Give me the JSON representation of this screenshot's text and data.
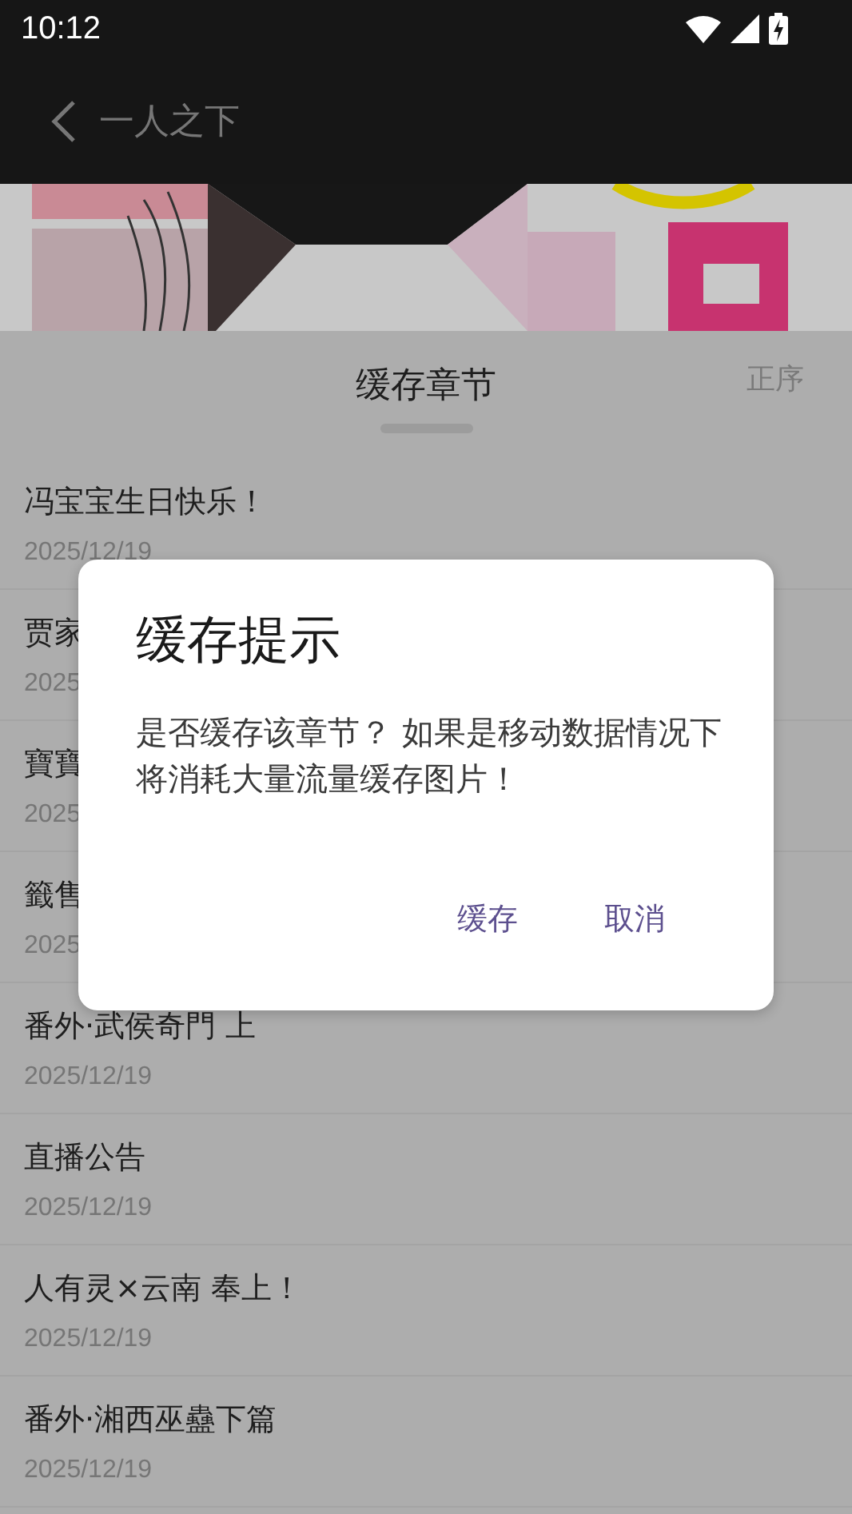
{
  "status_bar": {
    "time": "10:12"
  },
  "app_bar": {
    "title": "一人之下"
  },
  "sheet": {
    "title": "缓存章节",
    "sort": "正序"
  },
  "chapters": [
    {
      "title": "冯宝宝生日快乐！",
      "date": "2025/12/19"
    },
    {
      "title": "贾家",
      "date": "2025"
    },
    {
      "title": "寶寶",
      "date": "2025"
    },
    {
      "title": "籤售",
      "date": "2025"
    },
    {
      "title": "番外·武侯奇門 上",
      "date": "2025/12/19"
    },
    {
      "title": "直播公告",
      "date": "2025/12/19"
    },
    {
      "title": "人有灵×云南 奉上！",
      "date": "2025/12/19"
    },
    {
      "title": "番外·湘西巫蠱下篇",
      "date": "2025/12/19"
    }
  ],
  "dialog": {
    "title": "缓存提示",
    "message": "是否缓存该章节？ 如果是移动数据情况下将消耗大量流量缓存图片！",
    "buttons": [
      "缓存",
      "取消"
    ]
  }
}
